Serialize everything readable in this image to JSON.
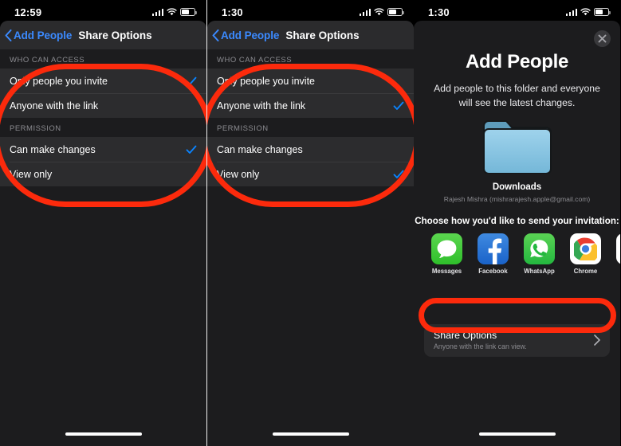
{
  "colors": {
    "accent_blue": "#3b8aff",
    "annotation_red": "#fc2a0c",
    "sheet_bg": "#1c1c1e",
    "row_bg": "#2c2c2e",
    "nav_bg": "#2b2b2d",
    "secondary_text": "#8b8b90"
  },
  "panels": [
    {
      "id": "panel-share-options-invite",
      "status_bar": {
        "time": "12:59",
        "cellular": "signal-bars-icon",
        "wifi": "wifi-icon",
        "battery": "battery-icon"
      },
      "nav": {
        "back_label": "Add People",
        "back_icon": "chevron-left-icon",
        "title": "Share Options"
      },
      "sections": [
        {
          "header": "WHO CAN ACCESS",
          "rows": [
            {
              "label": "Only people you invite",
              "checked": true
            },
            {
              "label": "Anyone with the link",
              "checked": false
            }
          ]
        },
        {
          "header": "PERMISSION",
          "rows": [
            {
              "label": "Can make changes",
              "checked": true
            },
            {
              "label": "View only",
              "checked": false
            }
          ]
        }
      ]
    },
    {
      "id": "panel-share-options-link",
      "status_bar": {
        "time": "1:30",
        "cellular": "signal-bars-icon",
        "wifi": "wifi-icon",
        "battery": "battery-icon"
      },
      "nav": {
        "back_label": "Add People",
        "back_icon": "chevron-left-icon",
        "title": "Share Options"
      },
      "sections": [
        {
          "header": "WHO CAN ACCESS",
          "rows": [
            {
              "label": "Only people you invite",
              "checked": false
            },
            {
              "label": "Anyone with the link",
              "checked": true
            }
          ]
        },
        {
          "header": "PERMISSION",
          "rows": [
            {
              "label": "Can make changes",
              "checked": false
            },
            {
              "label": "View only",
              "checked": true
            }
          ]
        }
      ]
    }
  ],
  "panel3": {
    "id": "panel-add-people",
    "status_bar": {
      "time": "1:30",
      "cellular": "signal-bars-icon",
      "wifi": "wifi-icon",
      "battery": "battery-icon"
    },
    "close_icon": "close-icon",
    "title": "Add People",
    "subtitle": "Add people to this folder and everyone will see the latest changes.",
    "folder": {
      "icon": "folder-icon",
      "name": "Downloads",
      "owner": "Rajesh Mishra (mishrarajesh.apple@gmail.com)"
    },
    "choose_label": "Choose how you'd like to send your invitation:",
    "apps": [
      {
        "label": "Messages",
        "icon": "messages-app-icon"
      },
      {
        "label": "Facebook",
        "icon": "facebook-app-icon"
      },
      {
        "label": "WhatsApp",
        "icon": "whatsapp-app-icon"
      },
      {
        "label": "Chrome",
        "icon": "chrome-app-icon"
      },
      {
        "label": "",
        "icon": "gmail-app-icon"
      }
    ],
    "share_options": {
      "title": "Share Options",
      "subtitle": "Anyone with the link can view.",
      "chevron": "chevron-right-icon"
    }
  }
}
